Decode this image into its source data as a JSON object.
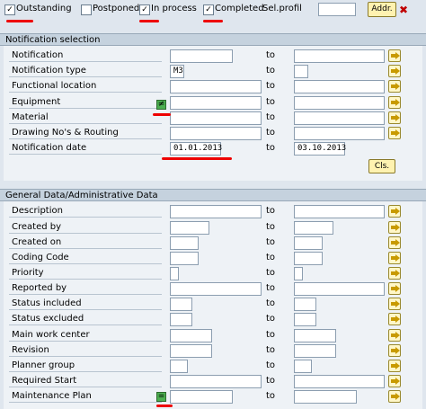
{
  "topbar": {
    "outstanding": {
      "label": "Outstanding",
      "checked": true
    },
    "postponed": {
      "label": "Postponed",
      "checked": false
    },
    "in_process": {
      "label": "In process",
      "checked": true
    },
    "completed": {
      "label": "Completed",
      "checked": true
    },
    "sel_profil_label": "Sel.profil",
    "sel_profil_value": "",
    "addr_button": "Addr."
  },
  "notification_selection": {
    "title": "Notification selection",
    "to_label": "to",
    "rows": [
      {
        "label": "Notification",
        "from": "",
        "to": ""
      },
      {
        "label": "Notification type",
        "from": "M3",
        "to": ""
      },
      {
        "label": "Functional location",
        "from": "",
        "to": ""
      },
      {
        "label": "Equipment",
        "from": "",
        "to": ""
      },
      {
        "label": "Material",
        "from": "",
        "to": ""
      },
      {
        "label": "Drawing No's & Routing",
        "from": "",
        "to": ""
      },
      {
        "label": "Notification date",
        "from": "01.01.2013",
        "to": "03.10.2013"
      }
    ],
    "cls_button": "Cls."
  },
  "general_data": {
    "title": "General Data/Administrative Data",
    "to_label": "to",
    "rows": [
      {
        "label": "Description",
        "from": "",
        "to": ""
      },
      {
        "label": "Created by",
        "from": "",
        "to": ""
      },
      {
        "label": "Created on",
        "from": "",
        "to": ""
      },
      {
        "label": "Coding Code",
        "from": "",
        "to": ""
      },
      {
        "label": "Priority",
        "from": "",
        "to": ""
      },
      {
        "label": "Reported by",
        "from": "",
        "to": ""
      },
      {
        "label": "Status included",
        "from": "",
        "to": ""
      },
      {
        "label": "Status excluded",
        "from": "",
        "to": ""
      },
      {
        "label": "Main work center",
        "from": "",
        "to": ""
      },
      {
        "label": "Revision",
        "from": "",
        "to": ""
      },
      {
        "label": "Planner group",
        "from": "",
        "to": ""
      },
      {
        "label": "Required Start",
        "from": "",
        "to": ""
      },
      {
        "label": "Maintenance Plan",
        "from": "",
        "to": ""
      }
    ]
  },
  "colors": {
    "highlight": "#e00000",
    "accent_button": "#fff2b0"
  }
}
